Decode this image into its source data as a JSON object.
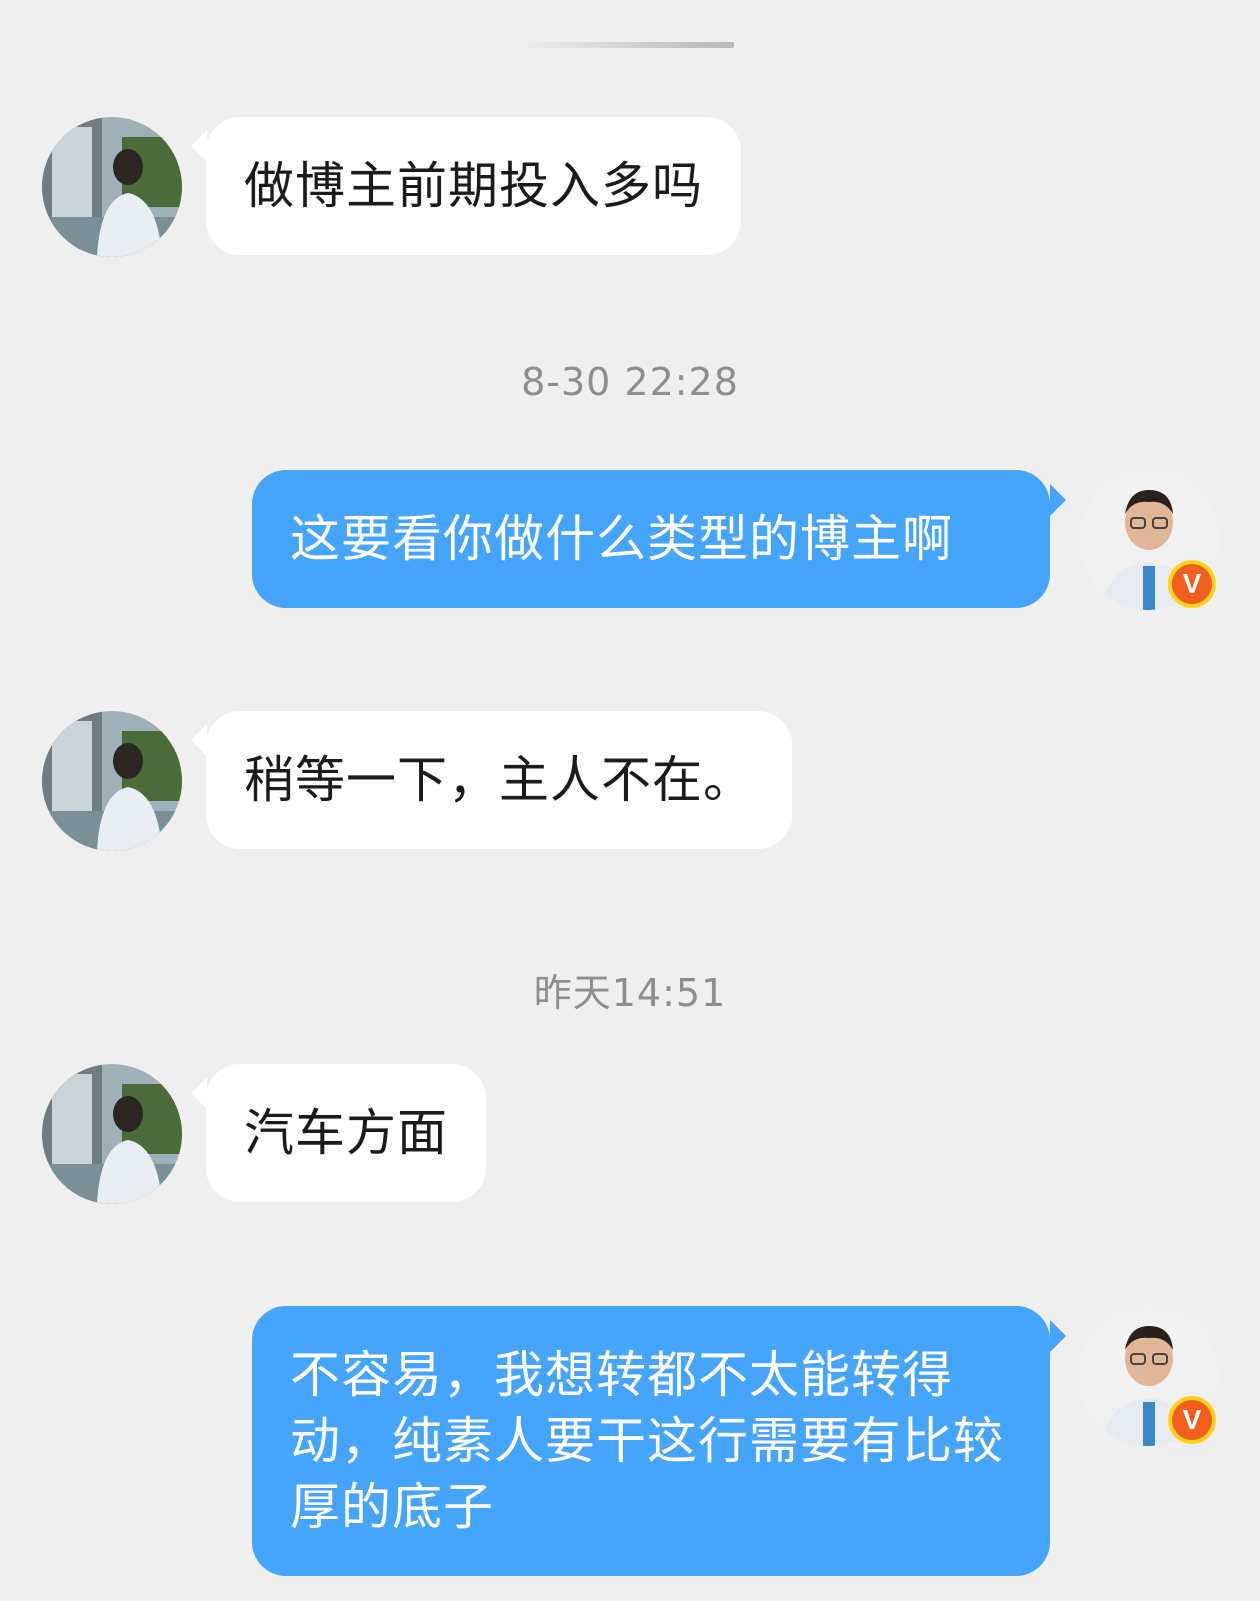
{
  "messages": [
    {
      "side": "incoming",
      "text": "做博主前期投入多吗"
    },
    {
      "timestamp": "8-30 22:28"
    },
    {
      "side": "outgoing",
      "text": "这要看你做什么类型的博主啊",
      "badge": "V"
    },
    {
      "side": "incoming",
      "text": "稍等一下，主人不在。"
    },
    {
      "timestamp": "昨天14:51"
    },
    {
      "side": "incoming",
      "text": "汽车方面"
    },
    {
      "side": "outgoing",
      "text": "不容易，我想转都不太能转得动，纯素人要干这行需要有比较厚的底子",
      "badge": "V"
    }
  ],
  "colors": {
    "background": "#efefef",
    "incoming_bubble": "#ffffff",
    "outgoing_bubble": "#45a4fb",
    "timestamp_text": "#8e8e8e",
    "verified_badge": "#f15e1e"
  },
  "icons": {
    "verified": "verified-v-badge-icon"
  }
}
